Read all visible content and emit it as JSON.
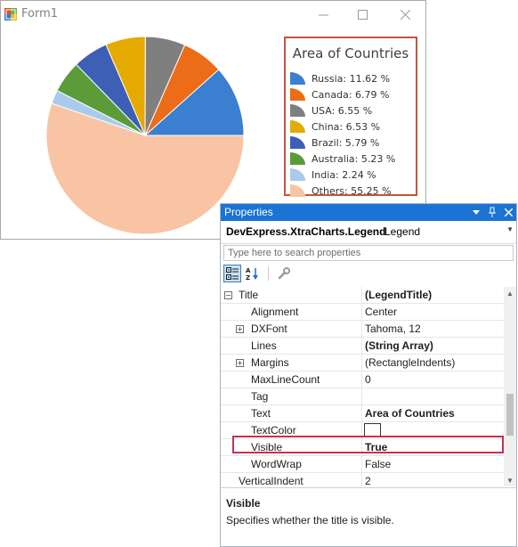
{
  "form": {
    "title": "Form1",
    "icon": "windows-forms-app-icon"
  },
  "chart": {
    "legend_title": "Area of Countries",
    "legend_items": [
      {
        "label": "Russia: 11.62 %",
        "color": "#3a7fd0"
      },
      {
        "label": "Canada: 6.79 %",
        "color": "#ec6c18"
      },
      {
        "label": "USA: 6.55 %",
        "color": "#7f7f7f"
      },
      {
        "label": "China: 6.53 %",
        "color": "#e4aa00"
      },
      {
        "label": "Brazil: 5.79 %",
        "color": "#3e5fb6"
      },
      {
        "label": "Australia: 5.23 %",
        "color": "#5b9b3a"
      },
      {
        "label": "India: 2.24 %",
        "color": "#a8cbed"
      },
      {
        "label": "Others: 55.25 %",
        "color": "#f8c4a4"
      }
    ]
  },
  "chart_data": {
    "type": "pie",
    "title": "Area of Countries",
    "legend_position": "right",
    "categories": [
      "Russia",
      "Canada",
      "USA",
      "China",
      "Brazil",
      "Australia",
      "India",
      "Others"
    ],
    "values": [
      11.62,
      6.79,
      6.55,
      6.53,
      5.79,
      5.23,
      2.24,
      55.25
    ],
    "colors": [
      "#3a7fd0",
      "#ec6c18",
      "#7f7f7f",
      "#e4aa00",
      "#3e5fb6",
      "#5b9b3a",
      "#a8cbed",
      "#f8c4a4"
    ]
  },
  "properties": {
    "panel_title": "Properties",
    "object_type": "DevExpress.XtraCharts.Legend",
    "object_name": "Legend",
    "search_placeholder": "Type here to search properties",
    "rows": [
      {
        "name": "Title",
        "value": "(LegendTitle)",
        "bold": true,
        "expander": "minus"
      },
      {
        "name": "Alignment",
        "value": "Center",
        "bold": false,
        "expander": ""
      },
      {
        "name": "DXFont",
        "value": "Tahoma, 12",
        "bold": false,
        "expander": "plus"
      },
      {
        "name": "Lines",
        "value": "(String Array)",
        "bold": true,
        "expander": ""
      },
      {
        "name": "Margins",
        "value": "(RectangleIndents)",
        "bold": false,
        "expander": "plus"
      },
      {
        "name": "MaxLineCount",
        "value": "0",
        "bold": false,
        "expander": ""
      },
      {
        "name": "Tag",
        "value": "",
        "bold": false,
        "expander": ""
      },
      {
        "name": "Text",
        "value": "Area of Countries",
        "bold": true,
        "expander": ""
      },
      {
        "name": "TextColor",
        "value": "",
        "bold": false,
        "expander": "",
        "swatch": "#ffffff"
      },
      {
        "name": "Visible",
        "value": "True",
        "bold": true,
        "expander": ""
      },
      {
        "name": "WordWrap",
        "value": "False",
        "bold": false,
        "expander": ""
      },
      {
        "name": "VerticalIndent",
        "value": "2",
        "bold": false,
        "expander": ""
      }
    ],
    "selected_row": "Visible",
    "description_title": "Visible",
    "description_text": "Specifies whether the title is visible."
  }
}
